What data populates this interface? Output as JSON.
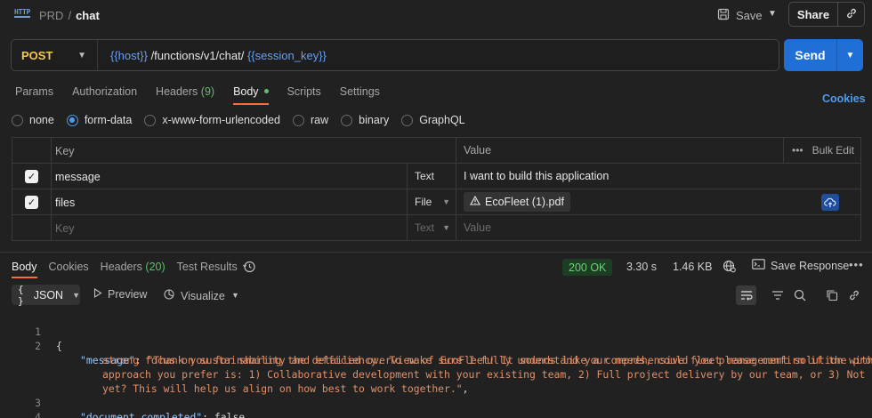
{
  "header": {
    "crumb_parent": "PRD",
    "crumb_separator": "/",
    "crumb_current": "chat",
    "http_badge": "HTTP",
    "save_label": "Save",
    "share_label": "Share"
  },
  "request": {
    "method": "POST",
    "url_var_host": "{{host}}",
    "url_path": " /functions/v1/chat/ ",
    "url_var_session": "{{session_key}}",
    "send_label": "Send"
  },
  "request_tabs": {
    "params": "Params",
    "authorization": "Authorization",
    "headers": "Headers",
    "headers_count": "(9)",
    "body": "Body",
    "scripts": "Scripts",
    "settings": "Settings",
    "cookies": "Cookies"
  },
  "body_types": {
    "none": "none",
    "form_data": "form-data",
    "urlencoded": "x-www-form-urlencoded",
    "raw": "raw",
    "binary": "binary",
    "graphql": "GraphQL",
    "selected": "form-data"
  },
  "params_table": {
    "col_key": "Key",
    "col_value": "Value",
    "bulk_edit": "Bulk Edit",
    "rows": [
      {
        "key": "message",
        "type": "Text",
        "value": "I want to build this application",
        "checked": true
      },
      {
        "key": "files",
        "type": "File",
        "value": "EcoFleet (1).pdf",
        "checked": true
      }
    ],
    "placeholder_key": "Key",
    "placeholder_type": "Text",
    "placeholder_value": "Value"
  },
  "response_tabs": {
    "body": "Body",
    "cookies": "Cookies",
    "headers": "Headers",
    "headers_count": "(20)",
    "test_results": "Test Results"
  },
  "response_meta": {
    "status": "200 OK",
    "time": "3.30 s",
    "size": "1.46 KB",
    "save_response": "Save Response"
  },
  "response_toolbar": {
    "format": "JSON",
    "format_icon": "{ }",
    "preview": "Preview",
    "visualize": "Visualize"
  },
  "response_body": {
    "line_numbers": [
      "1",
      "2",
      "3",
      "4"
    ],
    "open_brace": "{",
    "close_brace": "}",
    "message_key": "\"message\"",
    "message_line1": "\"Thank you for sharing the detailed overview of EcoFleet! It sounds like a comprehensive fleet management solution with a",
    "message_line2": "strong focus on sustainability and efficiency. To make sure I fully understand your needs, could you please confirm if the project",
    "message_line3": "approach you prefer is: 1) Collaborative development with your existing team, 2) Full project delivery by our team, or 3) Not sure",
    "message_line4": "yet? This will help us align on how best to work together.\"",
    "doc_key": "\"document_completed\"",
    "doc_value": "false"
  },
  "colors": {
    "accent_tab": "#ff6c37",
    "send": "#1f6fd6",
    "method": "#f2c94c",
    "status_ok": "#6ed07a",
    "json_key": "#9cc4f7",
    "json_string": "#e0906a"
  }
}
